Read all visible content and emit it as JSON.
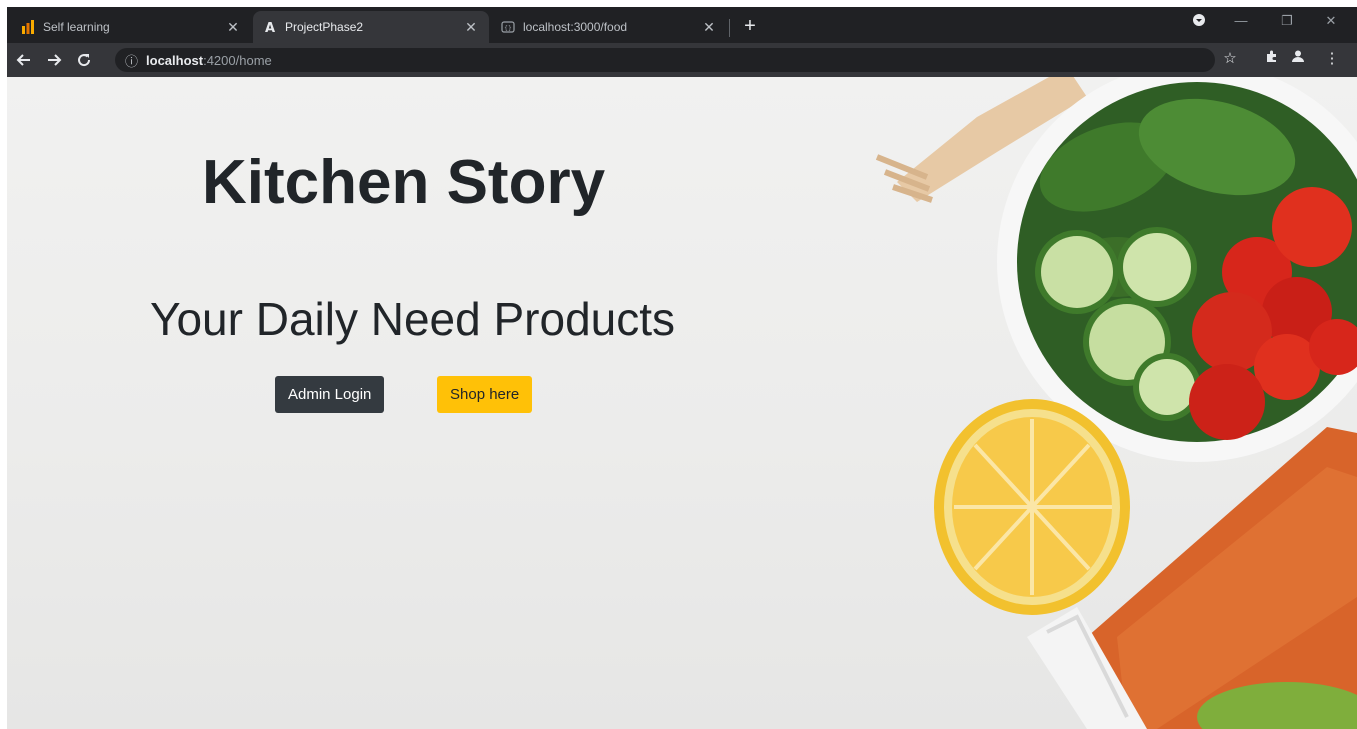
{
  "browser": {
    "tabs": [
      {
        "title": "Self learning",
        "favicon": "analytics-bars-icon",
        "active": false
      },
      {
        "title": "ProjectPhase2",
        "favicon": "angular-icon",
        "active": true
      },
      {
        "title": "localhost:3000/food",
        "favicon": "json-viewer-icon",
        "active": false
      }
    ],
    "address": {
      "host": "localhost",
      "path": ":4200/home"
    }
  },
  "page": {
    "title": "Kitchen Story",
    "subtitle": "Your Daily Need Products",
    "admin_button": "Admin Login",
    "shop_button": "Shop here"
  },
  "colors": {
    "title_text": "#212529",
    "admin_button_bg": "#343a40",
    "shop_button_bg": "#ffc107",
    "page_background": "#eeeeed"
  }
}
